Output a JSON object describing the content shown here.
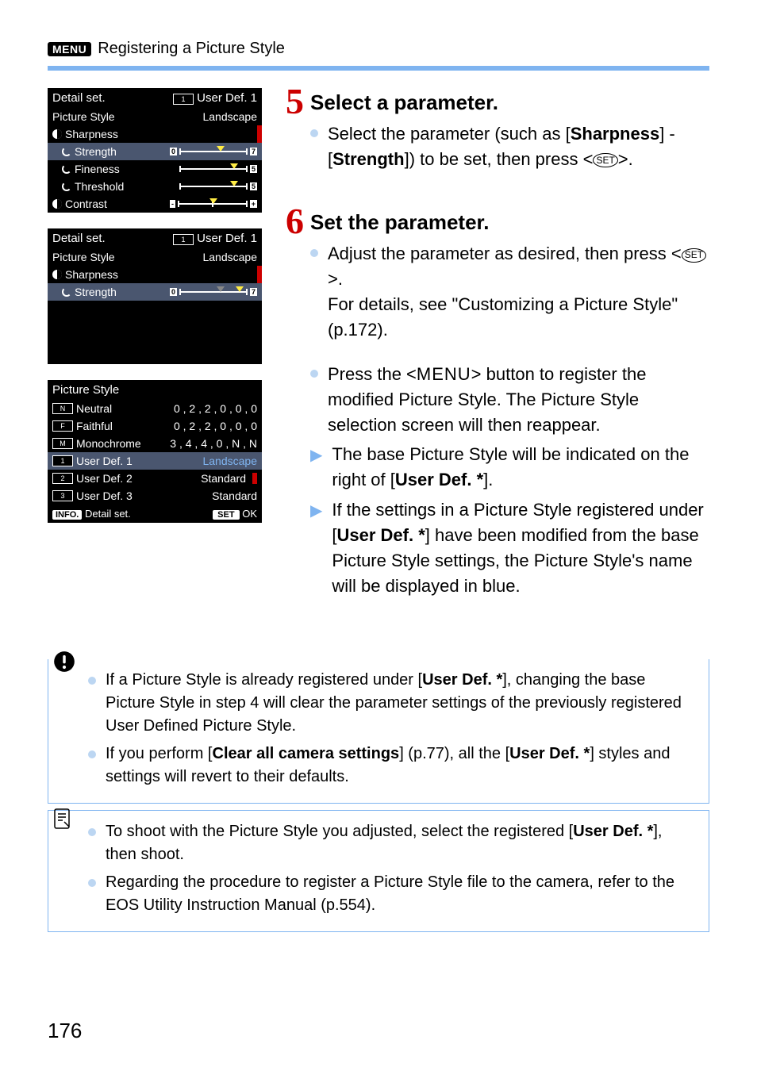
{
  "header": {
    "menu_badge": "MENU",
    "title": "Registering a Picture Style"
  },
  "panel1": {
    "title_left": "Detail set.",
    "title_right_icon": "1",
    "title_right": "User Def. 1",
    "picture_style_label": "Picture Style",
    "picture_style_value": "Landscape",
    "sharpness": "Sharpness",
    "strength": "Strength",
    "fineness": "Fineness",
    "threshold": "Threshold",
    "contrast": "Contrast",
    "slider_min": "0",
    "slider_max7": "7",
    "slider_max5": "5"
  },
  "panel2": {
    "title_left": "Detail set.",
    "title_right_icon": "1",
    "title_right": "User Def. 1",
    "picture_style_label": "Picture Style",
    "picture_style_value": "Landscape",
    "sharpness": "Sharpness",
    "strength": "Strength",
    "slider_min": "0",
    "slider_max7": "7"
  },
  "panel3": {
    "title": "Picture Style",
    "rows": [
      {
        "icon": "N",
        "name": "Neutral",
        "val": "0 , 2 , 2 , 0 , 0 , 0"
      },
      {
        "icon": "F",
        "name": "Faithful",
        "val": "0 , 2 , 2 , 0 , 0 , 0"
      },
      {
        "icon": "M",
        "name": "Monochrome",
        "val": "3 , 4 , 4 , 0 , N , N"
      },
      {
        "icon": "1",
        "name": "User Def. 1",
        "val": "Landscape",
        "sel": true
      },
      {
        "icon": "2",
        "name": "User Def. 2",
        "val": "Standard",
        "dot": true
      },
      {
        "icon": "3",
        "name": "User Def. 3",
        "val": "Standard"
      }
    ],
    "footer_info": "INFO.",
    "footer_detail": "Detail set.",
    "footer_set": "SET",
    "footer_ok": "OK"
  },
  "step5": {
    "num": "5",
    "title": "Select a parameter.",
    "b1_pre": "Select the parameter (such as [",
    "b1_s1": "Sharpness",
    "b1_mid": "] - [",
    "b1_s2": "Strength",
    "b1_post": "]) to be set, then press <",
    "b1_set": "SET",
    "b1_end": ">."
  },
  "step6": {
    "num": "6",
    "title": "Set the parameter.",
    "b1_a": "Adjust the parameter as desired, then press <",
    "b1_set": "SET",
    "b1_b": ">.",
    "b1_c": "For details, see \"Customizing a Picture Style\" (p.172).",
    "b2_a": "Press the <",
    "b2_menu": "MENU",
    "b2_b": "> button to register the modified Picture Style. The Picture Style selection screen will then reappear.",
    "b3_a": "The base Picture Style will be indicated on the right of [",
    "b3_u": "User Def. *",
    "b3_b": "].",
    "b4_a": "If the settings in a Picture Style registered under [",
    "b4_u": "User Def. *",
    "b4_b": "] have been modified from the base Picture Style settings, the Picture Style's name will be displayed in blue."
  },
  "notes1": {
    "n1_a": "If a Picture Style is already registered under [",
    "n1_u": "User Def. *",
    "n1_b": "], changing the base Picture Style in step 4 will clear the parameter settings of the previously registered User Defined Picture Style.",
    "n2_a": "If you perform [",
    "n2_c": "Clear all camera settings",
    "n2_b": "] (p.77), all the [",
    "n2_u": "User Def. *",
    "n2_d": "] styles and settings will revert to their defaults."
  },
  "notes2": {
    "n1_a": "To shoot with the Picture Style you adjusted, select the registered [",
    "n1_u": "User Def. *",
    "n1_b": "], then shoot.",
    "n2": "Regarding the procedure to register a Picture Style file to the camera, refer to the EOS Utility Instruction Manual (p.554)."
  },
  "page_number": "176"
}
